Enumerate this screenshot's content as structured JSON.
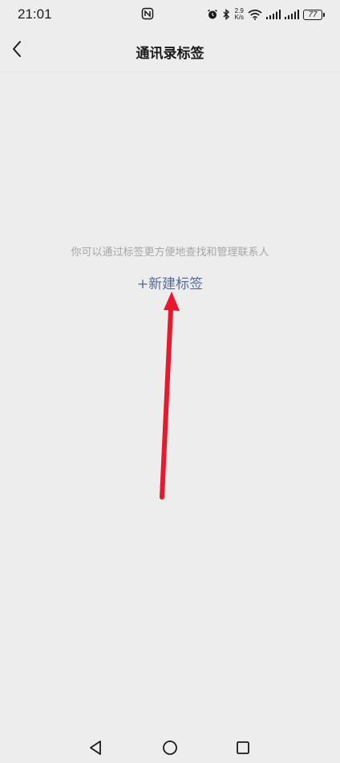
{
  "status_bar": {
    "time": "21:01",
    "net_speed_value": "2.9",
    "net_speed_unit": "K/s",
    "battery_level": "77"
  },
  "nav": {
    "title": "通讯录标签"
  },
  "content": {
    "hint": "你可以通过标签更方便地查找和管理联系人",
    "new_tag_plus": "+",
    "new_tag_label": "新建标签"
  },
  "annotation": {
    "arrow_color": "#e8192c"
  },
  "colors": {
    "background": "#ededed",
    "link": "#576b95",
    "hint": "#a6a6a6"
  }
}
